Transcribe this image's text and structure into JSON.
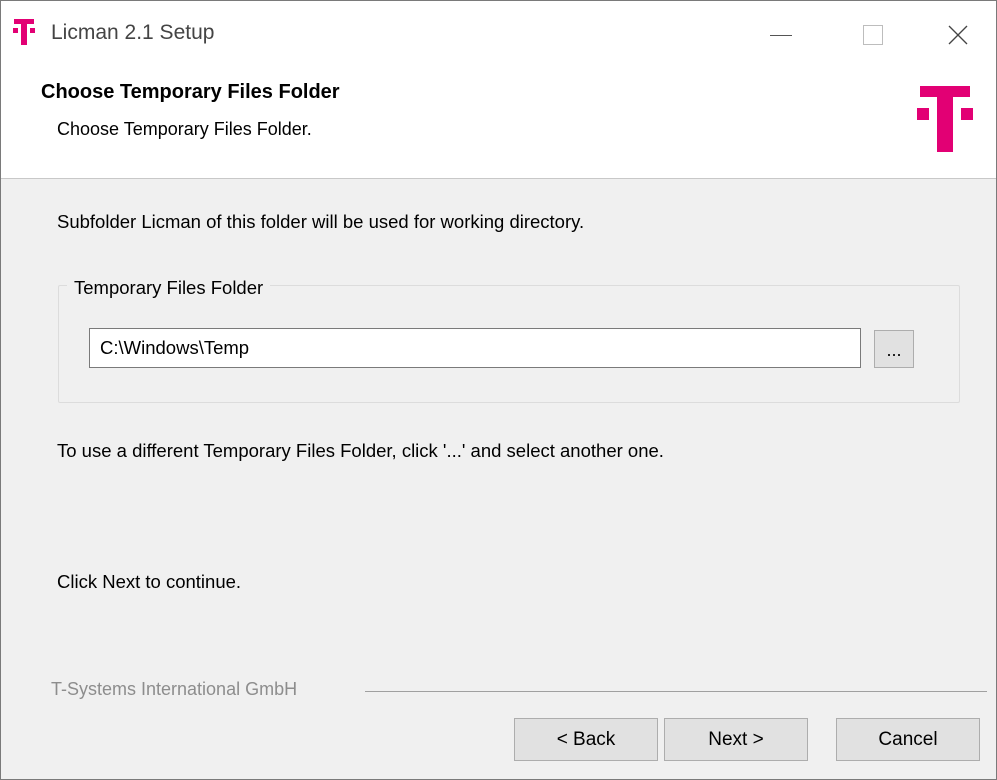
{
  "titlebar": {
    "title": "Licman 2.1 Setup",
    "controls": [
      "minimize-icon",
      "maximize-icon",
      "close-icon"
    ]
  },
  "header": {
    "title": "Choose Temporary Files Folder",
    "subtitle": "Choose Temporary Files Folder."
  },
  "logo": {
    "icon": "telekom-t-logo",
    "color": "#e20074"
  },
  "body": {
    "description": "Subfolder Licman of this folder will be used for working directory.",
    "group_label": "Temporary Files Folder",
    "folder_path": "C:\\Windows\\Temp",
    "browse_label": "...",
    "hint": "To use a different Temporary Files Folder, click '...' and select another one.",
    "continue_text": "Click Next to continue."
  },
  "footer": {
    "brand": "T-Systems International GmbH",
    "back_label": "< Back",
    "next_label": "Next >",
    "cancel_label": "Cancel"
  }
}
